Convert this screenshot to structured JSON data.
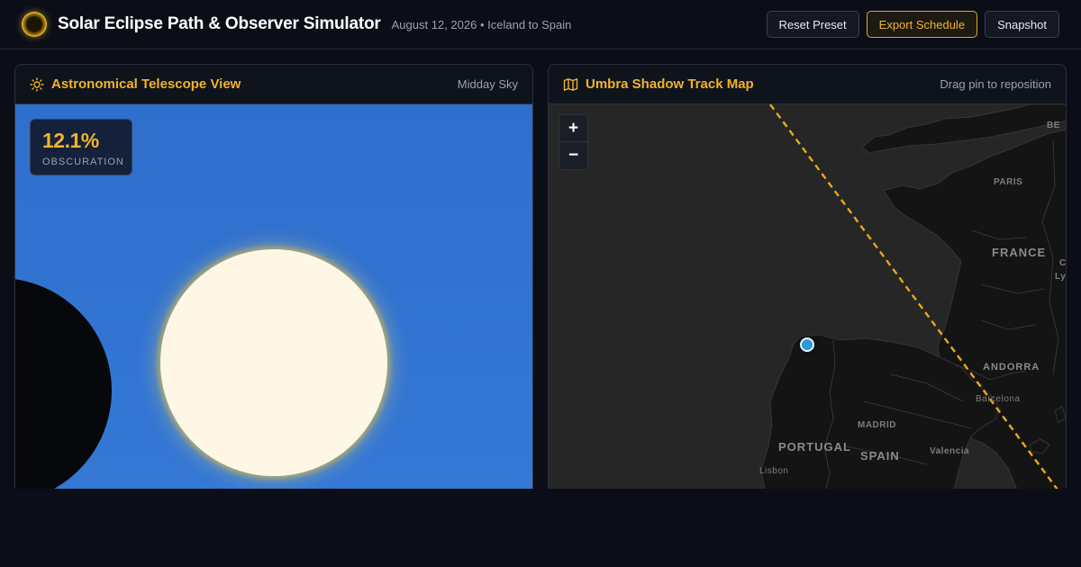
{
  "header": {
    "title": "Solar Eclipse Path & Observer Simulator",
    "subtitle_date": "August 12, 2026",
    "subtitle_route": "Iceland to Spain",
    "separator": "•",
    "buttons": {
      "reset": "Reset Preset",
      "export": "Export Schedule",
      "snapshot": "Snapshot"
    }
  },
  "telescope": {
    "title": "Astronomical Telescope View",
    "meta": "Midday Sky",
    "obscuration_value": "12.1%",
    "obscuration_label": "OBSCURATION",
    "icon": "sun-outline-icon"
  },
  "map": {
    "title": "Umbra Shadow Track Map",
    "meta": "Drag pin to reposition",
    "icon": "map-fold-icon",
    "zoom_in": "+",
    "zoom_out": "−",
    "labels": {
      "paris": "PARIS",
      "france": "FRANCE",
      "andorra": "ANDORRA",
      "barcelona": "Barcelona",
      "madrid": "MADRID",
      "portugal": "PORTUGAL",
      "spain": "SPAIN",
      "valencia": "Valencia",
      "lisbon": "Lisbon",
      "lyon": "Ly",
      "bern": "BE",
      "c_edge": "C"
    }
  },
  "colors": {
    "accent": "#f0b42a",
    "sky": "#3578d6",
    "track": "#e8a817",
    "pin": "#2a9ad8"
  }
}
